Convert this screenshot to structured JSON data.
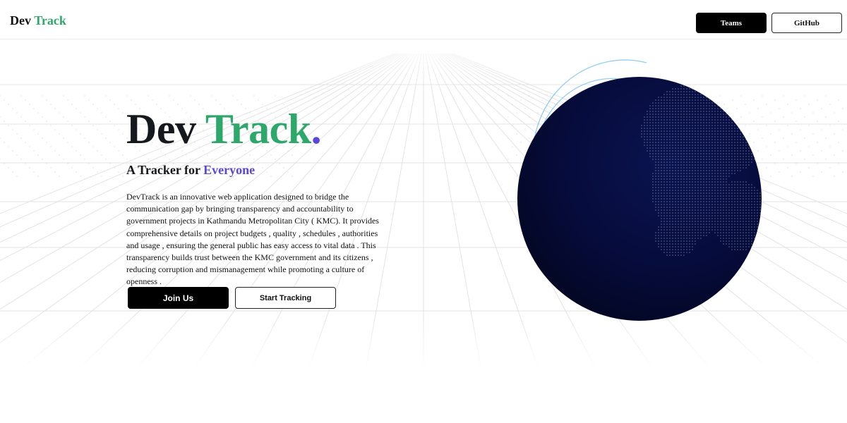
{
  "navbar": {
    "logo_part1": "Dev",
    "logo_part2": "Track",
    "teams_label": "Teams",
    "github_label": "GitHub"
  },
  "hero": {
    "title_part1": "Dev",
    "title_part2": "Track",
    "title_dot": ".",
    "subtitle_prefix": "A Tracker for",
    "subtitle_accent": "Everyone",
    "description": "DevTrack is an innovative web application designed to bridge the communication gap by bringing transparency and accountability to government projects in Kathmandu Metropolitan City ( KMC). It provides comprehensive details on project budgets , quality , schedules , authorities and usage , ensuring the general public has easy access to vital data . This transparency builds trust between the KMC government and its citizens , reducing corruption and mismanagement while promoting a culture of openness .",
    "join_label": "Join Us",
    "start_label": "Start Tracking"
  },
  "colors": {
    "brand_green": "#2ea86a",
    "accent_purple": "#5a47d9",
    "globe_dark": "#050a35",
    "arc_blue": "#7ec3ee"
  },
  "icons": {
    "globe": "globe-illustration"
  }
}
